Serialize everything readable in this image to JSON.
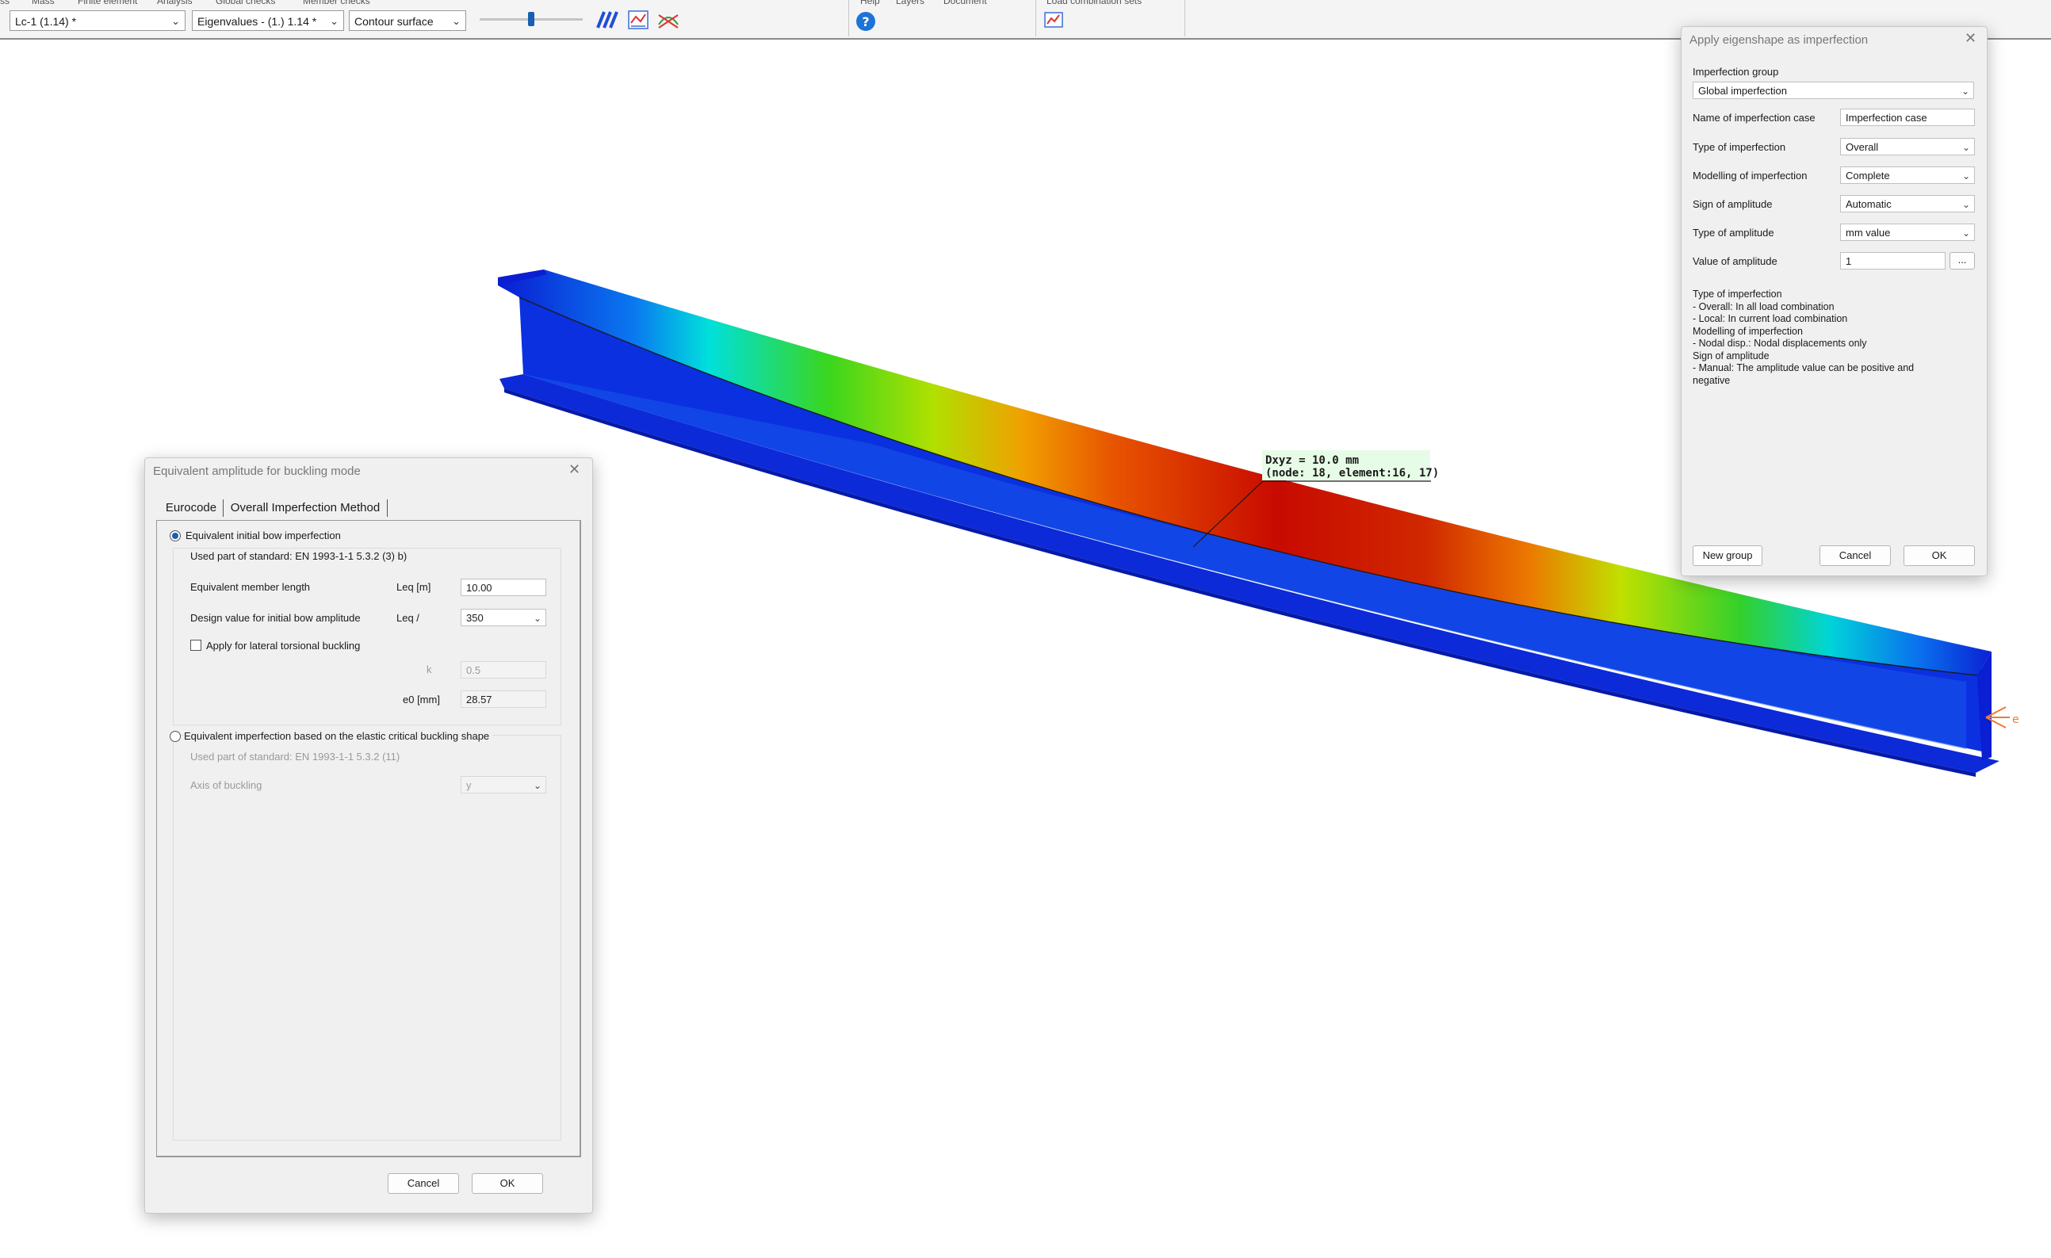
{
  "toolbar": {
    "top_cut_labels": [
      "ss",
      "Mass",
      "Finite element",
      "Analysis",
      "Global checks",
      "Member checks"
    ],
    "top_cut_right": [
      "Help",
      "Layers",
      "Document",
      "Load combination sets"
    ],
    "load_case": "Lc-1 (1.14) *",
    "eigenvalue": "Eigenvalues - (1.) 1.14 *",
    "display_mode": "Contour surface",
    "slider_fraction": 0.5
  },
  "viewport": {
    "callout_line1": "Dxyz = 10.0 mm",
    "callout_line2": "(node: 18, element:16, 17)",
    "support_marker": "e"
  },
  "dialog_left": {
    "title": "Equivalent amplitude for buckling mode",
    "tabs": [
      "Eurocode",
      "Overall Imperfection Method"
    ],
    "option1_label": "Equivalent initial bow imperfection",
    "option1_standard": "Used part of standard:  EN 1993-1-1 5.3.2 (3) b)",
    "member_length_label": "Equivalent member length",
    "member_length_sym": "Leq [m]",
    "member_length_value": "10.00",
    "design_value_label": "Design value for initial bow amplitude",
    "design_value_sym": "Leq /",
    "design_value_value": "350",
    "ltb_label": "Apply for lateral torsional buckling",
    "k_label": "k",
    "k_value": "0.5",
    "e0_label": "e0 [mm]",
    "e0_value": "28.57",
    "option2_label": "Equivalent imperfection based on the elastic critical buckling shape",
    "option2_standard": "Used part of standard:  EN 1993-1-1 5.3.2 (11)",
    "axis_label": "Axis of buckling",
    "axis_value": "y",
    "cancel": "Cancel",
    "ok": "OK"
  },
  "dialog_right": {
    "title": "Apply eigenshape as imperfection",
    "group_label": "Imperfection group",
    "group_value": "Global imperfection",
    "rows": [
      {
        "label": "Name of imperfection case",
        "value": "Imperfection case",
        "kind": "text"
      },
      {
        "label": "Type of imperfection",
        "value": "Overall",
        "kind": "select"
      },
      {
        "label": "Modelling of imperfection",
        "value": "Complete",
        "kind": "select"
      },
      {
        "label": "Sign of amplitude",
        "value": "Automatic",
        "kind": "select"
      },
      {
        "label": "Type of amplitude",
        "value": "mm value",
        "kind": "select"
      },
      {
        "label": "Value of amplitude",
        "value": "1",
        "kind": "text"
      }
    ],
    "ellipsis": "...",
    "help_lines": [
      "Type of imperfection",
      "- Overall: In all load combination",
      "- Local: In current load combination",
      "Modelling of imperfection",
      "- Nodal disp.: Nodal displacements only",
      "Sign of amplitude",
      "- Manual: The amplitude value can be positive and",
      "negative"
    ],
    "new_group": "New group",
    "cancel": "Cancel",
    "ok": "OK"
  },
  "colors": {
    "contour_low": "#0a1ed2",
    "contour_high": "#c80a00",
    "accent": "#1a5fb4"
  }
}
